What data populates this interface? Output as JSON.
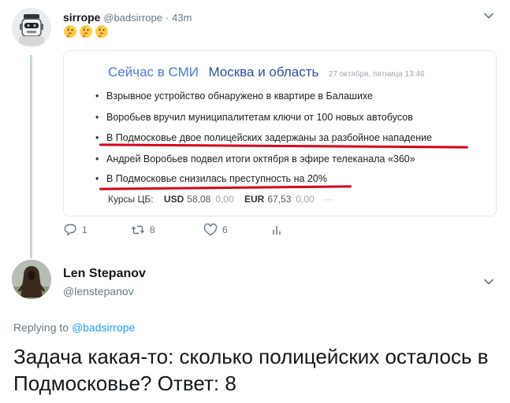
{
  "tweet1": {
    "name": "sirrope",
    "handle": "@badsirrope",
    "separator": "·",
    "time": "43m",
    "emojis": [
      "thinking-face-emoji",
      "thinking-face-emoji",
      "thinking-face-emoji"
    ],
    "card": {
      "source": "Сейчас в СМИ",
      "region": "Москва и область",
      "date": "27 октября, пятница 13:46",
      "bullet": "•",
      "news": [
        "Взрывное устройство обнаружено в квартире в Балашихе",
        "Воробьев вручил муниципалитетам ключи от 100 новых автобусов",
        "В Подмосковье двое полицейских задержаны за разбойное нападение",
        "Андрей Воробьев подвел итоги октября в эфире телеканала «360»",
        "В Подмосковье снизилась преступность на 20%"
      ],
      "rates": {
        "label": "Курсы ЦБ:",
        "usd_code": "USD",
        "usd_value": "58,08",
        "usd_change": "0,00",
        "eur_code": "EUR",
        "eur_value": "67,53",
        "eur_change": "0,00",
        "more": "···"
      }
    },
    "actions": {
      "replies": "1",
      "retweets": "8",
      "likes": "6"
    }
  },
  "tweet2": {
    "name": "Len Stepanov",
    "handle": "@lenstepanov",
    "replying_prefix": "Replying to",
    "replying_handle": "@badsirrope",
    "text": "Задача какая-то: сколько полицейских осталось в Подмосковье? Ответ: 8"
  },
  "colors": {
    "accent": "#1da1f2",
    "muted": "#657786",
    "underline": "#d9001b",
    "thread_line": "#ccd6dd"
  }
}
